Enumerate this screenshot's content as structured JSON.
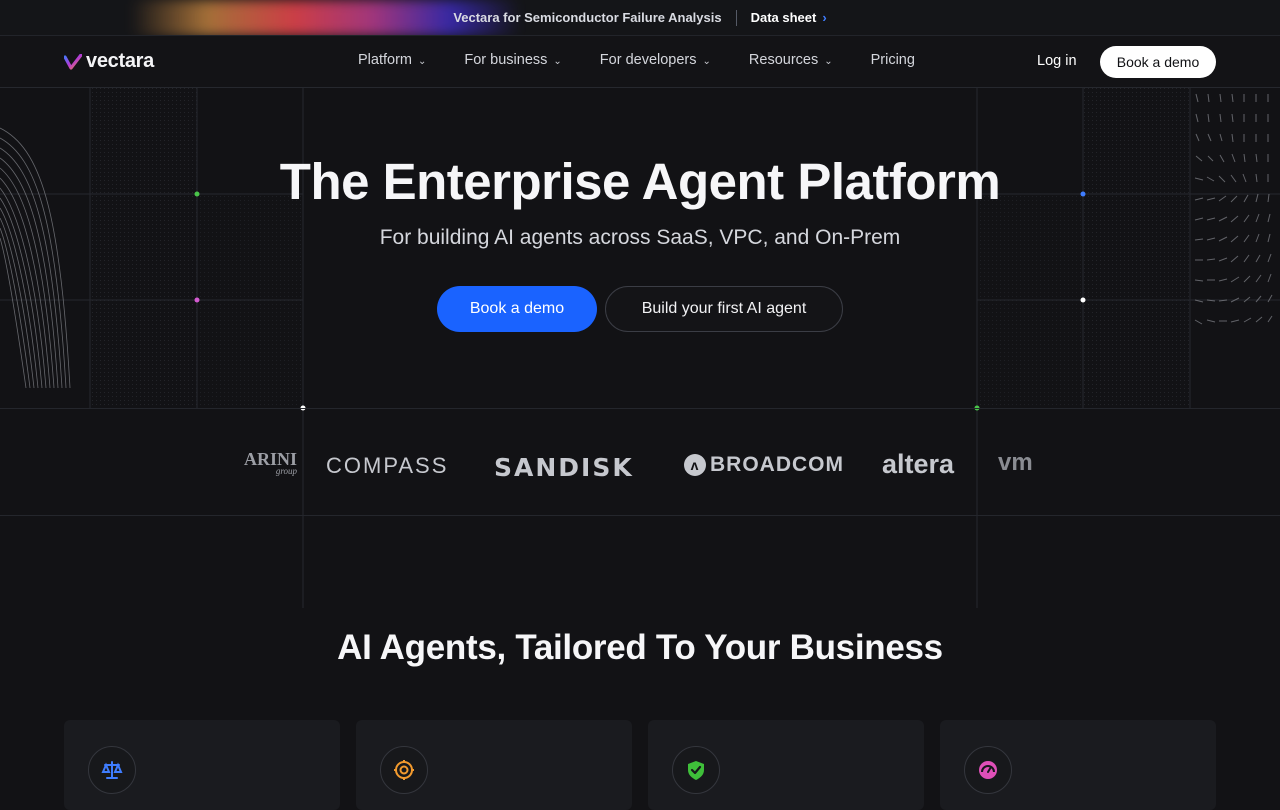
{
  "banner": {
    "title": "Vectara for Semiconductor Failure Analysis",
    "link_label": "Data sheet",
    "chevron_icon": "chevron-right-icon"
  },
  "nav": {
    "logo_text": "vectara",
    "items": [
      {
        "label": "Platform",
        "has_dropdown": true
      },
      {
        "label": "For business",
        "has_dropdown": true
      },
      {
        "label": "For developers",
        "has_dropdown": true
      },
      {
        "label": "Resources",
        "has_dropdown": true
      },
      {
        "label": "Pricing",
        "has_dropdown": false
      }
    ],
    "login_label": "Log in",
    "demo_label": "Book a demo"
  },
  "hero": {
    "title": "The Enterprise Agent Platform",
    "subtitle": "For building AI agents across SaaS, VPC, and On-Prem",
    "primary_cta": "Book a demo",
    "secondary_cta": "Build your first AI agent"
  },
  "customers": [
    {
      "name": "ARINI",
      "sub": "group"
    },
    {
      "name": "COMPASS"
    },
    {
      "name": "SANDISK"
    },
    {
      "name": "BROADCOM"
    },
    {
      "name": "altera"
    },
    {
      "name": "vm"
    }
  ],
  "section": {
    "title": "AI Agents, Tailored To Your Business"
  },
  "cards": [
    {
      "icon": "scale-icon",
      "color": "#3f7dff"
    },
    {
      "icon": "target-icon",
      "color": "#f29a2e"
    },
    {
      "icon": "shield-check-icon",
      "color": "#3fbf3a"
    },
    {
      "icon": "gauge-icon",
      "color": "#e04fb8"
    }
  ],
  "colors": {
    "accent": "#1a63ff",
    "background": "#121215"
  }
}
